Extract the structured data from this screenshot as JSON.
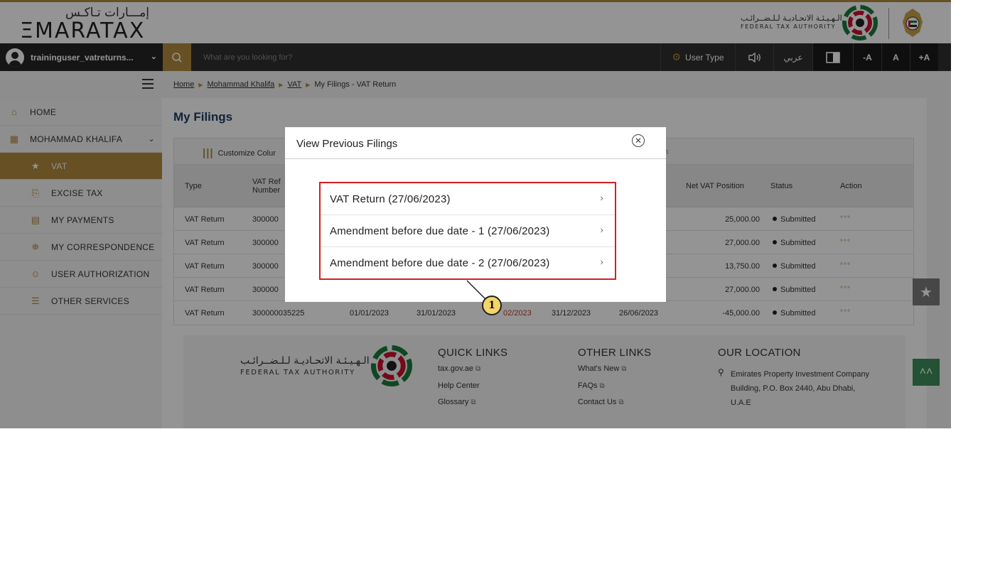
{
  "header": {
    "logo_ar": "إمـــارات تـاكـس",
    "logo_en": "ΞMARATAX",
    "authority_ar": "الـهـيـئـة الاتحـاديـة لـلـضــرائـب",
    "authority_en": "FEDERAL TAX AUTHORITY"
  },
  "topbar": {
    "username": "traininguser_vatreturns...",
    "search_placeholder": "What are you looking for?",
    "user_type_label": "User Type",
    "arabic_label": "عربي",
    "font_decrease": "-A",
    "font_normal": "A",
    "font_increase": "+A"
  },
  "breadcrumb": {
    "items": [
      "Home",
      "Mohammad Khalifa",
      "VAT"
    ],
    "current": "My Filings - VAT Return"
  },
  "sidebar": {
    "items": [
      {
        "label": "HOME",
        "icon": "home-icon"
      },
      {
        "label": "MOHAMMAD KHALIFA",
        "icon": "grid-icon"
      },
      {
        "label": "VAT",
        "icon": "vat-icon"
      },
      {
        "label": "EXCISE TAX",
        "icon": "excise-icon"
      },
      {
        "label": "MY PAYMENTS",
        "icon": "payments-icon"
      },
      {
        "label": "MY CORRESPONDENCE",
        "icon": "bank-icon"
      },
      {
        "label": "USER AUTHORIZATION",
        "icon": "user-auth-icon"
      },
      {
        "label": "OTHER SERVICES",
        "icon": "clipboard-icon"
      }
    ]
  },
  "main": {
    "title": "My Filings",
    "customize_label": "Customize Colur",
    "search_label": "rch",
    "columns": {
      "type": "Type",
      "vat_ref_1": "VAT Ref",
      "vat_ref_2": "Number",
      "net_vat": "Net VAT Position",
      "status": "Status",
      "action": "Action"
    },
    "rows": [
      {
        "type": "VAT Return",
        "ref": "300000",
        "net": "25,000.00",
        "status": "Submitted",
        "action": "°°°"
      },
      {
        "type": "VAT Return",
        "ref": "300000",
        "net": "27,000.00",
        "status": "Submitted",
        "action": "°°°"
      },
      {
        "type": "VAT Return",
        "ref": "300000",
        "net": "13,750.00",
        "status": "Submitted",
        "action": "°°°"
      },
      {
        "type": "VAT Return",
        "ref": "300000",
        "net": "27,000.00",
        "status": "Submitted",
        "action": "°°°"
      },
      {
        "type": "VAT Return",
        "ref": "300000035225",
        "from": "01/01/2023",
        "to": "31/01/2023",
        "due": "02/2023",
        "c5": "31/12/2023",
        "c6": "26/06/2023",
        "net": "-45,000.00",
        "status": "Submitted",
        "action": "°°°"
      }
    ]
  },
  "footer": {
    "authority_ar": "الـهـيـئـة الاتحـاديـة لـلـضــرائـب",
    "authority_en": "FEDERAL TAX AUTHORITY",
    "quick_links_title": "QUICK LINKS",
    "quick_links": [
      "tax.gov.ae",
      "Help Center",
      "Glossary"
    ],
    "other_links_title": "OTHER LINKS",
    "other_links": [
      "What's New",
      "FAQs",
      "Contact Us"
    ],
    "location_title": "OUR LOCATION",
    "address": "Emirates Property Investment Company Building, P.O. Box 2440, Abu Dhabi, U.A.E"
  },
  "modal": {
    "title": "View Previous Filings",
    "items": [
      "VAT Return (27/06/2023)",
      "Amendment before due date - 1 (27/06/2023)",
      "Amendment before due date - 2 (27/06/2023)"
    ]
  },
  "callout": {
    "number": "1"
  },
  "colors": {
    "accent_gold": "#b08a3e",
    "title_navy": "#1e3a5f",
    "highlight_red": "#d61f1f",
    "callout_yellow": "#f4d56a",
    "scroll_top_green": "#3e8e5a"
  }
}
